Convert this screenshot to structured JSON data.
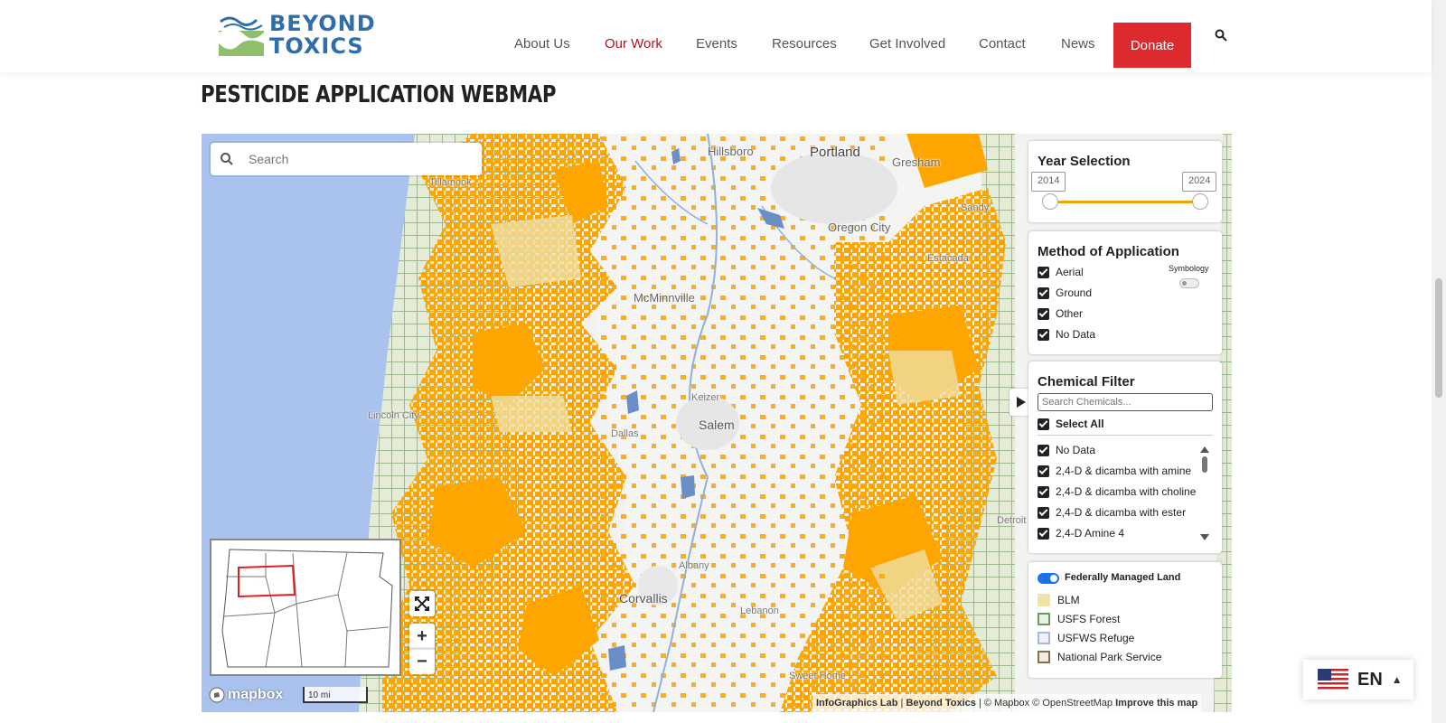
{
  "header": {
    "logo_line1": "BEYOND",
    "logo_line2": "TOXICS",
    "nav": [
      "About Us",
      "Our Work",
      "Events",
      "Resources",
      "Get Involved",
      "Contact",
      "News"
    ],
    "active_nav": "Our Work",
    "donate_label": "Donate",
    "brand_color": "#2f6ea8",
    "donate_color": "#dd2a2f"
  },
  "page_title": "PESTICIDE APPLICATION WEBMAP",
  "map": {
    "search_placeholder": "Search",
    "places": {
      "hillsboro": "Hillsboro",
      "portland": "Portland",
      "gresham": "Gresham",
      "tillamook": "Tillamook",
      "sandy": "Sandy",
      "oregon_city": "Oregon City",
      "estacada": "Estacada",
      "mcminnville": "McMinnville",
      "keizer": "Keizer",
      "salem": "Salem",
      "dallas": "Dallas",
      "lincoln_city": "Lincoln City",
      "albany": "Albany",
      "corvallis": "Corvallis",
      "lebanon": "Lebanon",
      "sweet_home": "Sweet Home",
      "detroit": "Detroit"
    },
    "application_color": "#ffa500",
    "mapbox_label": "mapbox",
    "scale_label": "10 mi",
    "attribution": {
      "infographics": "InfoGraphics Lab",
      "separator1": "|",
      "beyond": "Beyond Toxics",
      "rest": "| © Mapbox © OpenStreetMap",
      "improve": "Improve this map"
    },
    "zoom_in": "+",
    "zoom_out": "−"
  },
  "year_selection": {
    "title": "Year Selection",
    "start": "2014",
    "end": "2024",
    "slider_color": "#f5a200"
  },
  "method": {
    "title": "Method of Application",
    "options": [
      "Aerial",
      "Ground",
      "Other",
      "No Data"
    ],
    "symbology_label": "Symbology",
    "symbology_on": false
  },
  "chemical": {
    "title": "Chemical Filter",
    "search_placeholder": "Search Chemicals...",
    "select_all": "Select All",
    "items": [
      "No Data",
      "2,4-D & dicamba with amine",
      "2,4-D & dicamba with choline",
      "2,4-D & dicamba with ester",
      "2,4-D Amine 4"
    ]
  },
  "federal_land": {
    "title": "Federally Managed Land",
    "enabled": true,
    "legend": [
      {
        "label": "BLM",
        "fill": "#f0e3a8",
        "border": "#f0e3a8"
      },
      {
        "label": "USFS Forest",
        "fill": "#e8f2e0",
        "border": "#6e9a62"
      },
      {
        "label": "USFWS Refuge",
        "fill": "#eef2fa",
        "border": "#a9b8d6"
      },
      {
        "label": "National Park Service",
        "fill": "#f0ebe4",
        "border": "#8a6e50"
      }
    ]
  },
  "language": {
    "code": "EN"
  }
}
